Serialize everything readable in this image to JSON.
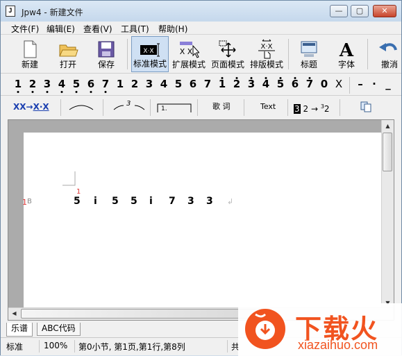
{
  "window": {
    "title": "Jpw4 - 新建文件",
    "app_icon": "J",
    "controls": {
      "minimize": "—",
      "maximize": "▢",
      "close": "✕"
    }
  },
  "menu": [
    "文件(F)",
    "编辑(E)",
    "查看(V)",
    "工具(T)",
    "帮助(H)"
  ],
  "toolbar": {
    "buttons": [
      {
        "label": "新建",
        "icon": "new-file-icon"
      },
      {
        "label": "打开",
        "icon": "open-folder-icon"
      },
      {
        "label": "保存",
        "icon": "save-disk-icon"
      },
      {
        "label": "标准模式",
        "icon": "standard-mode-icon",
        "icon_text": "X·X",
        "active": true
      },
      {
        "label": "扩展模式",
        "icon": "extended-mode-icon",
        "icon_text": "X X"
      },
      {
        "label": "页面模式",
        "icon": "page-mode-icon"
      },
      {
        "label": "排版模式",
        "icon": "layout-mode-icon",
        "icon_text": "X·X"
      },
      {
        "label": "标题",
        "icon": "title-icon"
      },
      {
        "label": "字体",
        "icon": "font-icon",
        "icon_text": "A"
      },
      {
        "label": "撤消",
        "icon": "undo-icon"
      }
    ]
  },
  "notes_toolbar": {
    "low_dot_notes": [
      "1",
      "2",
      "3",
      "4",
      "5",
      "6",
      "7"
    ],
    "plain_notes": [
      "1",
      "2",
      "3",
      "4",
      "5",
      "6",
      "7"
    ],
    "high_dot_notes": [
      "1",
      "2",
      "3",
      "4",
      "5",
      "6",
      "7"
    ],
    "rest": "0",
    "x": "X",
    "dash": "–",
    "dot": "·",
    "underline": "_"
  },
  "format_toolbar": {
    "convert_from": "XX",
    "convert_arrow": "→",
    "convert_to": "X·X",
    "triplet_mark": "3",
    "box_one": "1.",
    "lyrics": "歌 词",
    "text": "Text",
    "transpose_from": "3",
    "transpose_mid": "2",
    "transpose_arrow": "→",
    "transpose_sup": "3",
    "transpose_to": "2"
  },
  "score": {
    "line_label": "1",
    "line_label_suffix": "B",
    "high_mark": "1",
    "notes": [
      "5",
      "i",
      "5",
      "5",
      "i",
      "7",
      "3",
      "3"
    ],
    "end_mark": "↲"
  },
  "tabs": [
    "乐谱",
    "ABC代码"
  ],
  "status": {
    "mode": "标准",
    "zoom": "100%",
    "position": "第0小节, 第1页,第1行,第8列",
    "extra": "共"
  },
  "watermark": {
    "main": "下载火",
    "sub": "xiazaihuo.com"
  }
}
